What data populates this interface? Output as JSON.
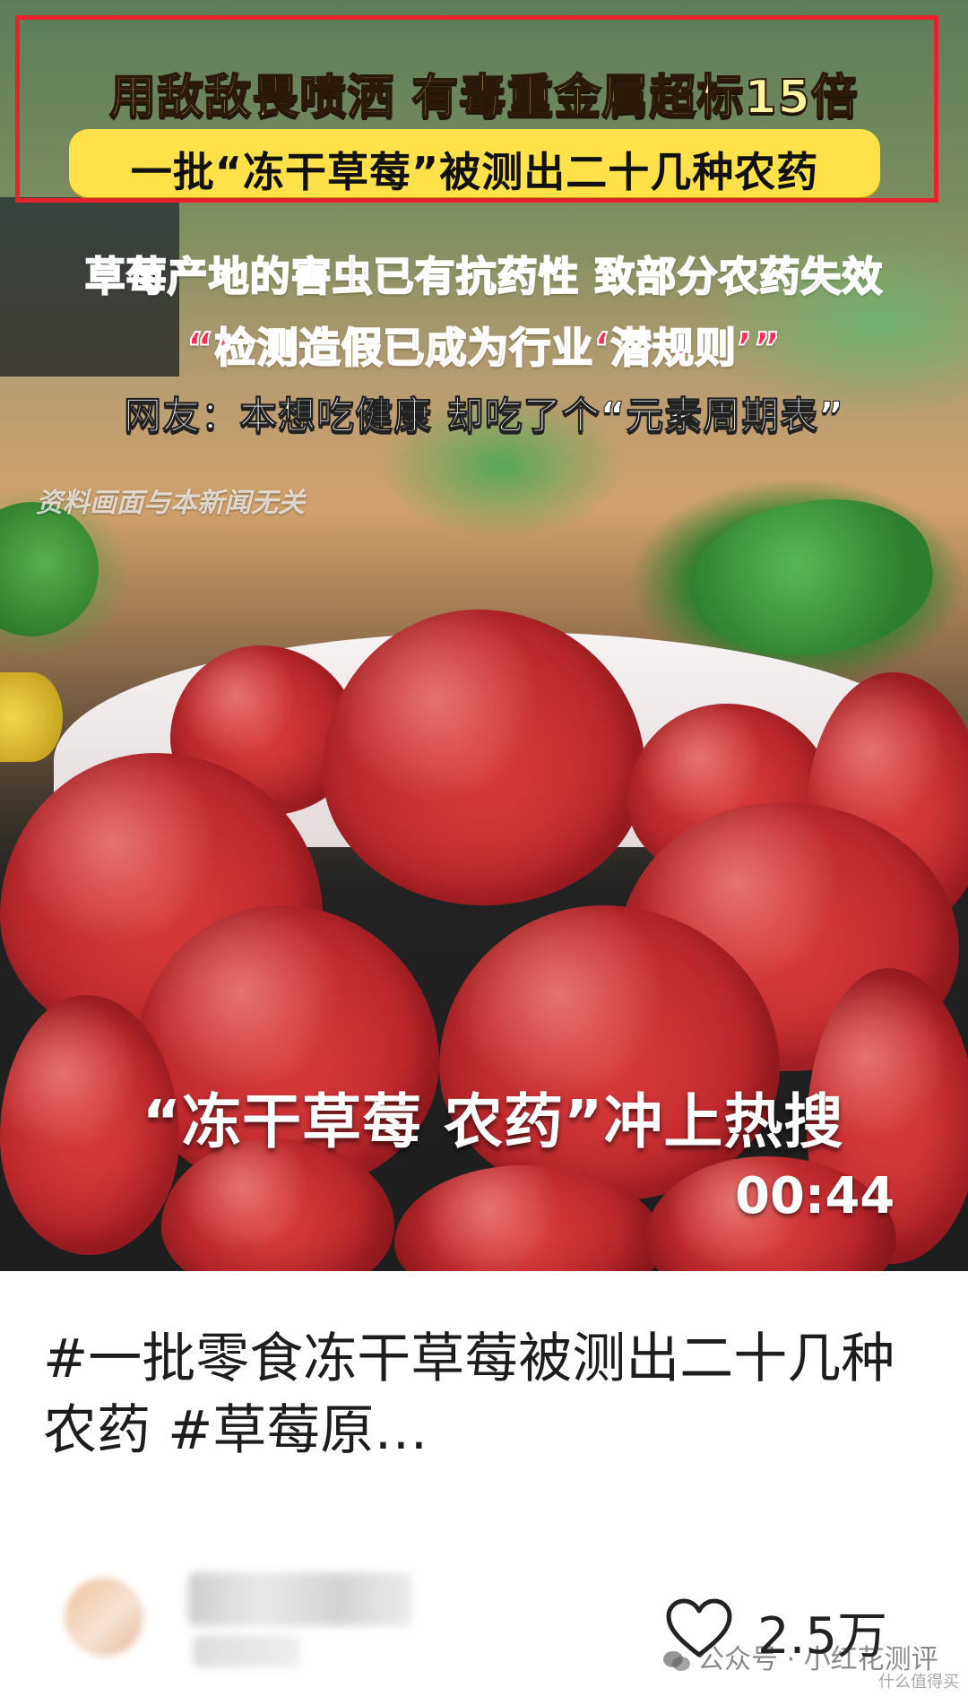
{
  "cover": {
    "headline_1": "用敌敌畏喷洒 有毒重金属超标15倍",
    "headline_2": "一批“冻干草莓”被测出二十几种农药",
    "headline_3": "草莓产地的害虫已有抗药性 致部分农药失效",
    "headline_4": "“检测造假已成为行业‘潜规则’”",
    "headline_5": "网友：本想吃健康 却吃了个“元素周期表”",
    "disclaimer": "资料画面与本新闻无关",
    "overlay_title": "“冻干草莓 农药”冲上热搜",
    "duration": "00:44",
    "highlight_color": "#e8222c"
  },
  "post": {
    "title": "#一批零食冻干草莓被测出二十几种农药 #草莓原…"
  },
  "author": {
    "avatar_icon": "avatar",
    "username": "",
    "like_icon": "heart-outline-icon",
    "like_count": "2.5万"
  },
  "watermark": {
    "icon": "wechat-icon",
    "text": "公众号 · 小红花测评",
    "sub": "什么值得买"
  }
}
